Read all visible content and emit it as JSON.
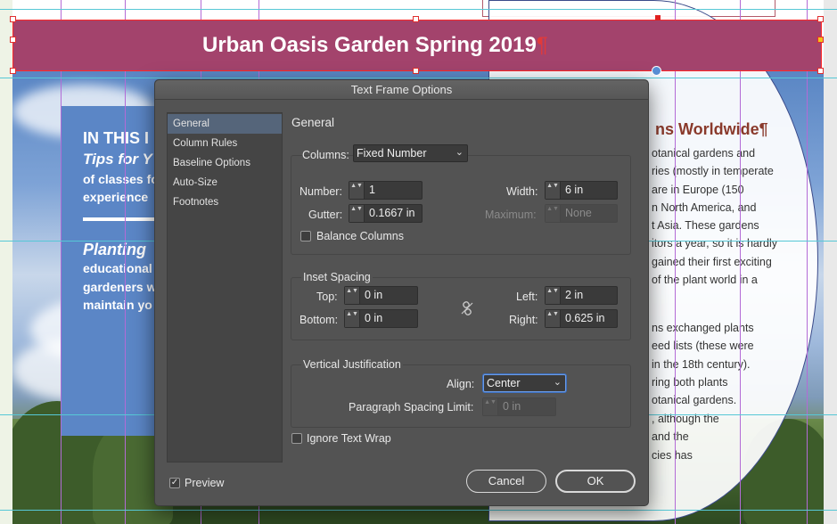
{
  "document": {
    "banner_title": "Urban Oasis Garden Spring 2019",
    "pilcrow": "¶",
    "sidebar": {
      "heading": "IN THIS I",
      "subheading": "Tips for Y",
      "line1": "of classes fo",
      "line2": "experience",
      "planting": "Planting",
      "body1": "educational",
      "body2": "gardeners w",
      "body3": "maintain yo"
    },
    "article": {
      "heading": "ns Worldwide¶",
      "lines": [
        "otanical gardens and",
        "ries (mostly in temperate",
        "are in Europe (150",
        "n North America, and",
        "t Asia. These gardens",
        "itors a year, so it is hardly",
        "gained their first exciting",
        "of the plant world in a",
        "ns exchanged plants",
        "eed lists (these were",
        "in the 18th century).",
        "ring both plants",
        "otanical gardens.",
        ", although the",
        "and the",
        "cies has"
      ]
    },
    "colors": {
      "banner": "#a3436c",
      "sidebar": "#5b86c6",
      "article_heading": "#8a3a2c"
    }
  },
  "dialog": {
    "title": "Text Frame Options",
    "categories": [
      "General",
      "Column Rules",
      "Baseline Options",
      "Auto-Size",
      "Footnotes"
    ],
    "selected_category": "General",
    "section_title": "General",
    "columns": {
      "label": "Columns:",
      "type_value": "Fixed Number",
      "number_label": "Number:",
      "number_value": "1",
      "width_label": "Width:",
      "width_value": "6 in",
      "gutter_label": "Gutter:",
      "gutter_value": "0.1667 in",
      "maximum_label": "Maximum:",
      "maximum_value": "None",
      "balance_label": "Balance Columns",
      "balance_checked": false
    },
    "inset": {
      "title": "Inset Spacing",
      "top_label": "Top:",
      "top_value": "0 in",
      "bottom_label": "Bottom:",
      "bottom_value": "0 in",
      "left_label": "Left:",
      "left_value": "2 in",
      "right_label": "Right:",
      "right_value": "0.625 in"
    },
    "vertical": {
      "title": "Vertical Justification",
      "align_label": "Align:",
      "align_value": "Center",
      "spacing_label": "Paragraph Spacing Limit:",
      "spacing_value": "0 in"
    },
    "ignore_wrap_label": "Ignore Text Wrap",
    "ignore_wrap_checked": false,
    "preview_label": "Preview",
    "preview_checked": true,
    "cancel_label": "Cancel",
    "ok_label": "OK",
    "check_glyph": "✓",
    "arrows_glyph": "▲▼",
    "chevron_glyph": "⌄"
  }
}
